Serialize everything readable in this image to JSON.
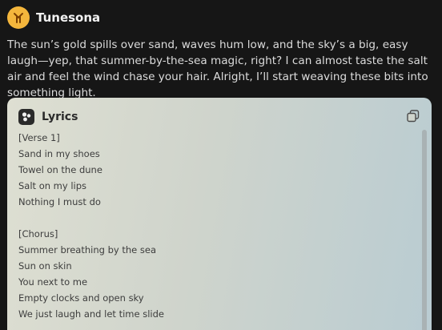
{
  "app": {
    "name": "Tunesona",
    "avatar_icon": "tunesona-logo-icon",
    "avatar_color": "#f4b63c"
  },
  "message": {
    "text": "The sun’s gold spills over sand, waves hum low, and the sky’s a big, easy laugh—yep, that summer-by-the-sea magic, right? I can almost taste the salt air and feel the wind chase your hair. Alright, I’ll start weaving these bits into something light."
  },
  "lyrics_card": {
    "title": "Lyrics",
    "icon": "lyrics-icon",
    "copy_icon": "copy-icon",
    "lines": [
      "[Verse 1]",
      "Sand in my shoes",
      "Towel on the dune",
      "Salt on my lips",
      "Nothing I must do",
      "",
      "[Chorus]",
      "Summer breathing by the sea",
      "Sun on skin",
      "You next to me",
      "Empty clocks and open sky",
      "We just laugh and let time slide"
    ]
  }
}
